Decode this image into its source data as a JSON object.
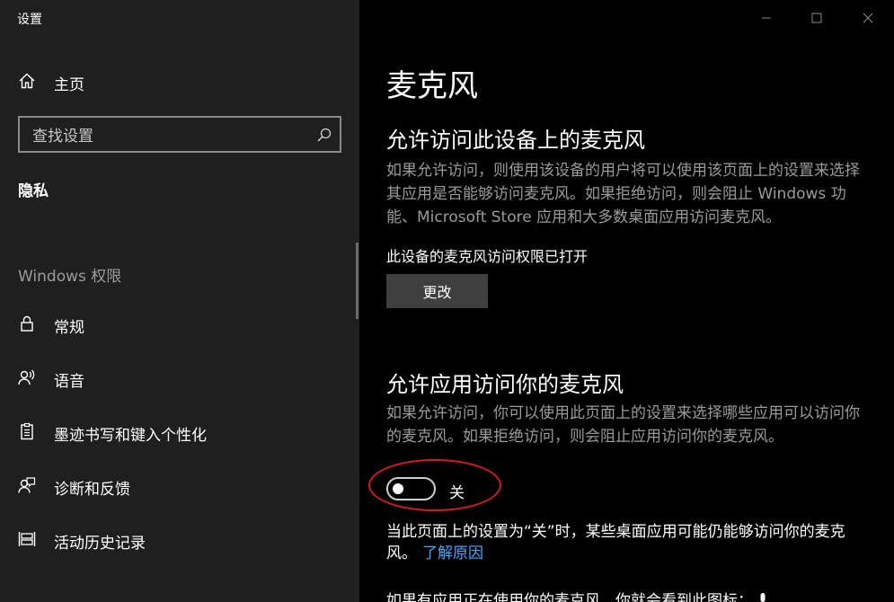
{
  "window": {
    "title": "设置"
  },
  "sidebar": {
    "home_label": "主页",
    "search_placeholder": "查找设置",
    "current_category": "隐私",
    "section_heading": "Windows 权限",
    "items": [
      {
        "label": "常规",
        "icon": "lock-icon"
      },
      {
        "label": "语音",
        "icon": "speech-icon"
      },
      {
        "label": "墨迹书写和键入个性化",
        "icon": "clipboard-icon"
      },
      {
        "label": "诊断和反馈",
        "icon": "feedback-icon"
      },
      {
        "label": "活动历史记录",
        "icon": "timeline-icon"
      }
    ]
  },
  "main": {
    "title": "麦克风",
    "device_section": {
      "heading": "允许访问此设备上的麦克风",
      "description": "如果允许访问，则使用该设备的用户将可以使用该页面上的设置来选择其应用是否能够访问麦克风。如果拒绝访问，则会阻止 Windows 功能、Microsoft Store 应用和大多数桌面应用访问麦克风。",
      "status": "此设备的麦克风访问权限已打开",
      "change_button": "更改"
    },
    "app_section": {
      "heading": "允许应用访问你的麦克风",
      "description": "如果允许访问，你可以使用此页面上的设置来选择哪些应用可以访问你的麦克风。如果拒绝访问，则会阻止应用访问你的麦克风。",
      "toggle_state": "关",
      "note": "当此页面上的设置为“关”时，某些桌面应用可能仍能够访问你的麦克风。",
      "note_link": "了解原因",
      "partial_text": "如果有应用正在使用你的麦克风，你就会看到此图标："
    }
  },
  "colors": {
    "sidebar_bg": "#1f1f1f",
    "main_bg": "#000000",
    "muted_text": "#9b9b9b",
    "link": "#4aa3ff",
    "highlight": "#d61d1d",
    "button_bg": "#3f3f3f"
  }
}
